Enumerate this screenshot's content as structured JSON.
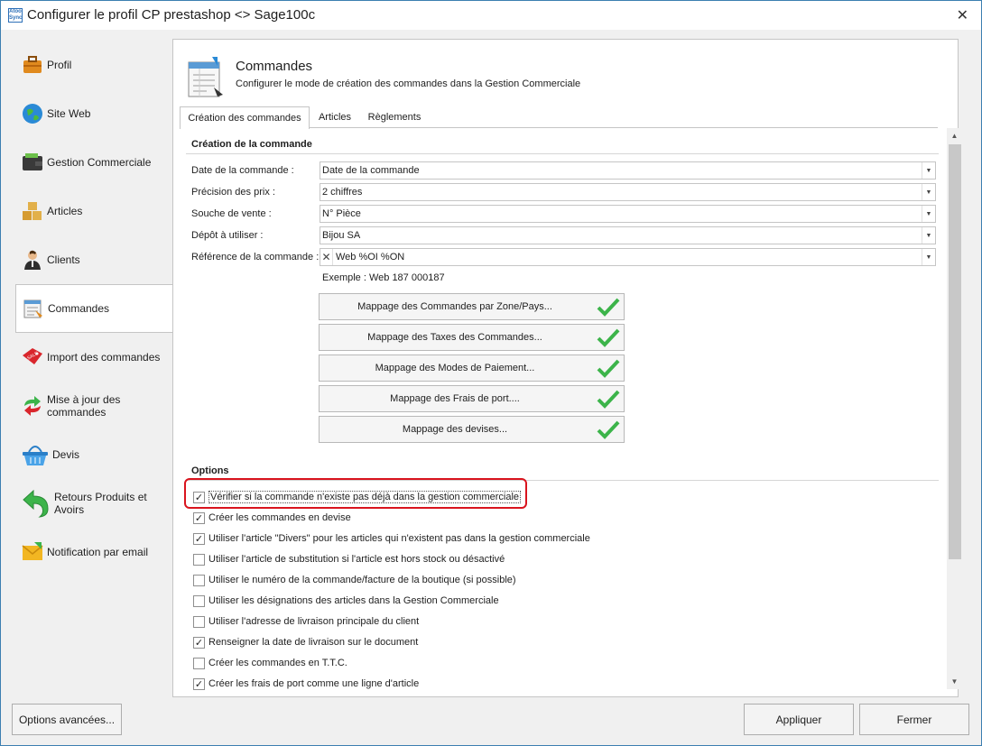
{
  "window": {
    "title": "Configurer le profil CP prestashop <> Sage100c",
    "app_icon_text": "Atoo Sync",
    "close_glyph": "✕"
  },
  "sidebar": {
    "items": [
      {
        "label": "Profil",
        "icon": "briefcase-icon"
      },
      {
        "label": "Site Web",
        "icon": "globe-icon"
      },
      {
        "label": "Gestion Commerciale",
        "icon": "wallet-icon"
      },
      {
        "label": "Articles",
        "icon": "boxes-icon"
      },
      {
        "label": "Clients",
        "icon": "person-icon"
      },
      {
        "label": "Commandes",
        "icon": "order-sheet-icon",
        "selected": true
      },
      {
        "label": "Import des commandes",
        "icon": "sale-tag-icon"
      },
      {
        "label": "Mise à jour des commandes",
        "icon": "refresh-arrows-icon"
      },
      {
        "label": "Devis",
        "icon": "basket-icon"
      },
      {
        "label": "Retours Produits et Avoirs",
        "icon": "return-arrow-icon"
      },
      {
        "label": "Notification par email",
        "icon": "envelope-icon"
      }
    ]
  },
  "header": {
    "title": "Commandes",
    "subtitle": "Configurer le mode de création des commandes dans la Gestion Commerciale"
  },
  "tabs": [
    {
      "label": "Création des commandes",
      "active": true
    },
    {
      "label": "Articles",
      "active": false
    },
    {
      "label": "Règlements",
      "active": false
    }
  ],
  "creation": {
    "section_title": "Création de la commande",
    "fields": [
      {
        "label": "Date de la commande :",
        "value": "Date de la commande"
      },
      {
        "label": "Précision des prix :",
        "value": "2 chiffres"
      },
      {
        "label": "Souche de vente :",
        "value": "N° Pièce"
      },
      {
        "label": "Dépôt à utiliser :",
        "value": "Bijou SA"
      },
      {
        "label": "Référence de la commande :",
        "value": "Web %OI %ON"
      }
    ],
    "example": "Exemple : Web 187 000187",
    "mapping_buttons": [
      "Mappage des Commandes par Zone/Pays...",
      "Mappage des Taxes des Commandes...",
      "Mappage des Modes de Paiement...",
      "Mappage des Frais de port....",
      "Mappage des devises..."
    ]
  },
  "options": {
    "section_title": "Options",
    "items": [
      {
        "label": "Vérifier si la commande n'existe pas déjà dans la gestion commerciale",
        "checked": true
      },
      {
        "label": "Créer les commandes en devise",
        "checked": true
      },
      {
        "label": "Utiliser l'article \"Divers\" pour les articles qui n'existent pas dans la gestion commerciale",
        "checked": true
      },
      {
        "label": "Utiliser l'article de substitution si l'article est hors stock ou désactivé",
        "checked": false
      },
      {
        "label": "Utiliser le numéro de la commande/facture de la boutique (si possible)",
        "checked": false
      },
      {
        "label": "Utiliser les désignations des articles dans la Gestion Commerciale",
        "checked": false
      },
      {
        "label": "Utiliser l'adresse de livraison principale du client",
        "checked": false
      },
      {
        "label": "Renseigner la date de livraison sur le document",
        "checked": true
      },
      {
        "label": "Créer les commandes en T.T.C.",
        "checked": false
      },
      {
        "label": "Créer les frais de port comme une ligne d'article",
        "checked": true
      }
    ]
  },
  "footer": {
    "advanced_label": "Options avancées...",
    "apply_label": "Appliquer",
    "close_label": "Fermer"
  },
  "colors": {
    "check_green": "#3cb44a",
    "highlight_red": "#d9141e",
    "window_border": "#3c7fb1"
  }
}
